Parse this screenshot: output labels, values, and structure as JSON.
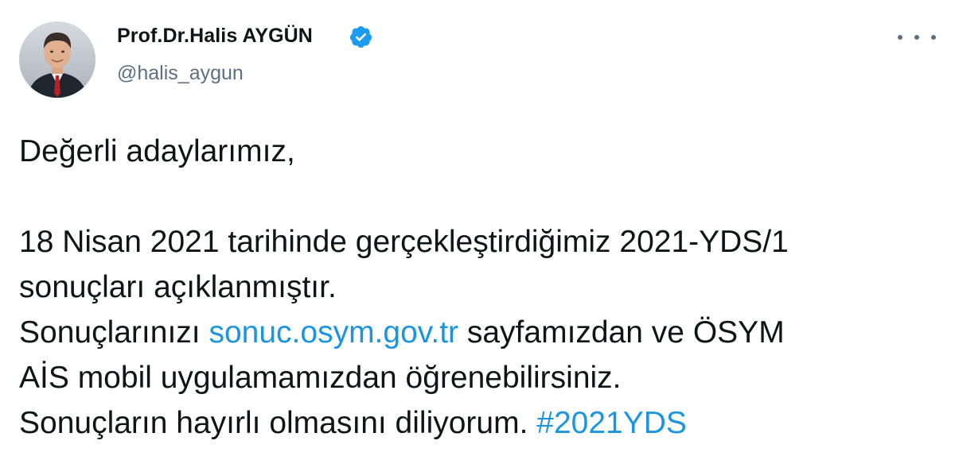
{
  "author": {
    "display_name": "Prof.Dr.Halis AYGÜN",
    "handle": "@halis_aygun",
    "verified_icon": "verified-badge-icon",
    "avatar_icon": "profile-photo"
  },
  "more_menu": {
    "icon": "more-horizontal-icon"
  },
  "tweet": {
    "line1": "Değerli adaylarımız,",
    "line2": "18 Nisan 2021 tarihinde gerçekleştirdiğimiz 2021-YDS/1",
    "line3": "sonuçları açıklanmıştır.",
    "line4_prefix": "Sonuçlarınızı ",
    "line4_link": "sonuc.osym.gov.tr",
    "line4_suffix": " sayfamızdan ve ÖSYM",
    "line5": "AİS mobil uygulamamızdan öğrenebilirsiniz.",
    "line6_prefix": "Sonuçların hayırlı olmasını diliyorum. ",
    "line6_hashtag": "#2021YDS"
  },
  "colors": {
    "text": "#0f1419",
    "secondary": "#5b7083",
    "link": "#1b95e0",
    "verified": "#1d9bf0"
  }
}
